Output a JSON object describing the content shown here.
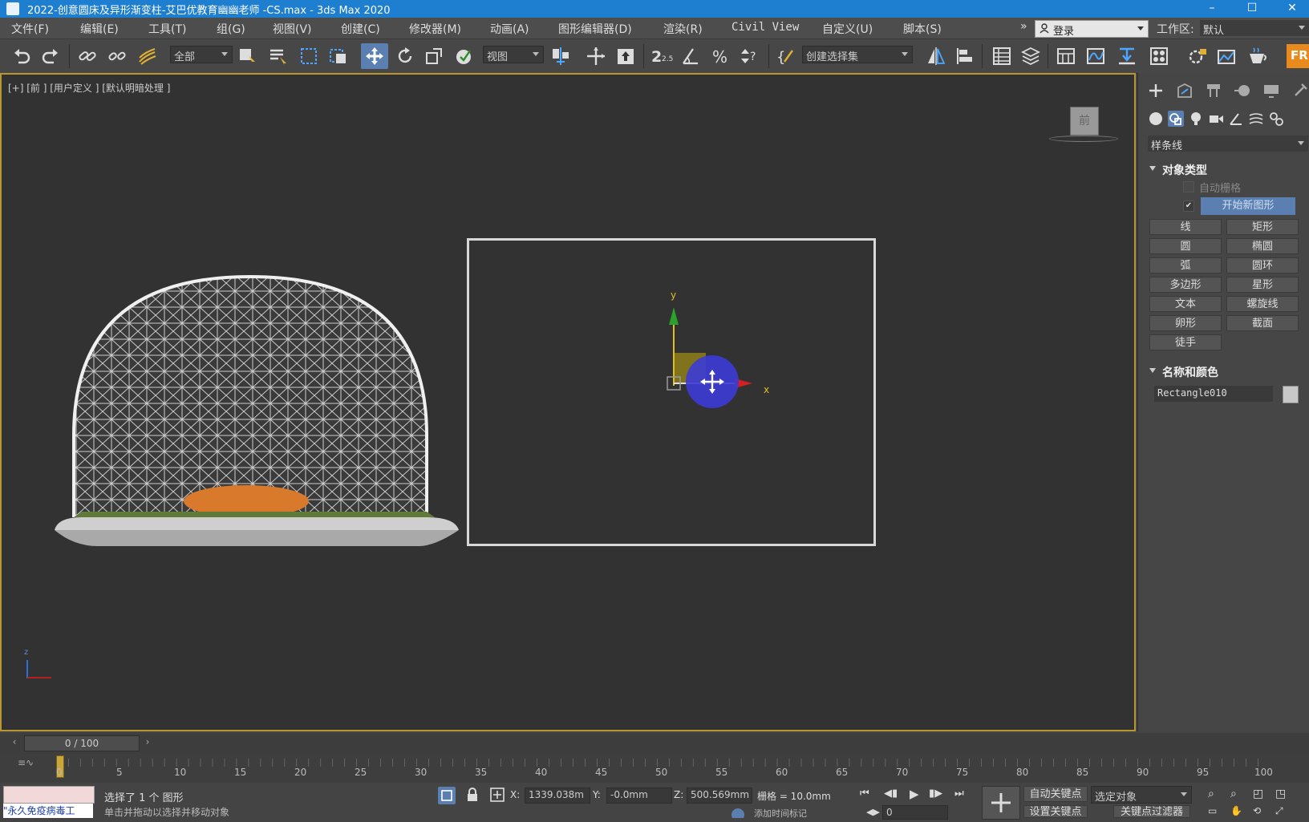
{
  "titlebar": {
    "title": "2022-创意圆床及异形渐变柱-艾巴优教育幽幽老师 -CS.max - 3ds Max 2020",
    "minimize": "–",
    "maximize": "☐",
    "close": "✕"
  },
  "menubar": {
    "items": [
      "文件(F)",
      "编辑(E)",
      "工具(T)",
      "组(G)",
      "视图(V)",
      "创建(C)",
      "修改器(M)",
      "动画(A)",
      "图形编辑器(D)",
      "渲染(R)",
      "Civil View",
      "自定义(U)",
      "脚本(S)"
    ],
    "overflow": "»",
    "login": "登录",
    "workspace_label": "工作区:",
    "workspace_value": "默认"
  },
  "toolbar": {
    "filter": "全部",
    "ref_coord": "视图",
    "spinner_snap": "2.5",
    "selection_set": "创建选择集"
  },
  "viewport": {
    "label": "[+] [前 ] [用户定义 ] [默认明暗处理 ]",
    "viewcube_label": "前",
    "gizmo_x": "x",
    "gizmo_y": "y",
    "axis_tripod_z": "z"
  },
  "command_panel": {
    "category": "样条线",
    "object_type_title": "对象类型",
    "autogrid": "自动栅格",
    "start_new_shape": "开始新图形",
    "shape_buttons": [
      "线",
      "矩形",
      "圆",
      "椭圆",
      "弧",
      "圆环",
      "多边形",
      "星形",
      "文本",
      "螺旋线",
      "卵形",
      "截面",
      "徒手"
    ],
    "name_color_title": "名称和颜色",
    "object_name": "Rectangle010",
    "object_color": "#c8c8c8"
  },
  "timeline": {
    "frame_display": "0 / 100",
    "ticks": [
      "0",
      "5",
      "10",
      "15",
      "20",
      "25",
      "30",
      "35",
      "40",
      "45",
      "50",
      "55",
      "60",
      "65",
      "70",
      "75",
      "80",
      "85",
      "90",
      "95",
      "100"
    ]
  },
  "statusbar": {
    "maxscript_text": "\"永久免疫病毒工",
    "status_text": "选择了 1 个 图形",
    "prompt_text": "单击并拖动以选择并移动对象",
    "x_label": "X:",
    "x_value": "1339.038m",
    "y_label": "Y:",
    "y_value": "-0.0mm",
    "z_label": "Z:",
    "z_value": "500.569mm",
    "grid_text": "栅格 = 10.0mm",
    "auto_key": "自动关键点",
    "selected_object": "选定对象",
    "set_key": "设置关键点",
    "key_filters": "关键点过滤器",
    "add_time_tag": "添加时间标记",
    "frame_value": "0"
  },
  "colors": {
    "titlebar": "#1e7ecf",
    "viewport_border": "#b9962f",
    "active_tool": "#5a7fb0",
    "gizmo_x": "#d42020",
    "gizmo_y": "#2ca02c",
    "gizmo_center": "#3b3bd6"
  }
}
